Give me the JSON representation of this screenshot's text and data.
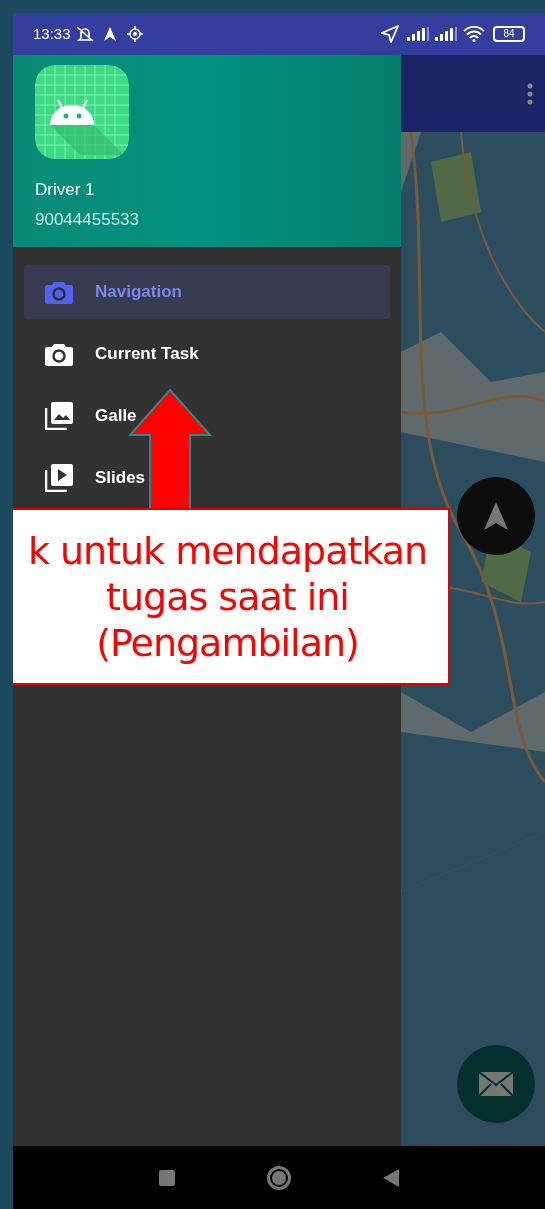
{
  "status_bar": {
    "time": "13:33",
    "battery": "84"
  },
  "drawer": {
    "user_name": "Driver 1",
    "phone": "90044455533",
    "items": [
      {
        "label": "Navigation",
        "kind": "camera",
        "selected": true
      },
      {
        "label": "Current Task",
        "kind": "camera",
        "selected": false
      },
      {
        "label": "Galle",
        "kind": "gallery",
        "selected": false
      },
      {
        "label": "Slides",
        "kind": "slides",
        "selected": false
      }
    ]
  },
  "callout": {
    "text": "k untuk mendapatkan\ntugas saat ini\n(Pengambilan)"
  }
}
